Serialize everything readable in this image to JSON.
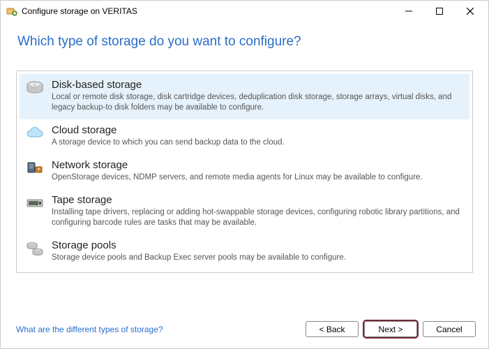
{
  "window": {
    "title": "Configure storage on VERITAS",
    "minimize": "Minimize",
    "maximize": "Maximize",
    "close": "Close"
  },
  "heading": "Which type of storage do you want to configure?",
  "options": [
    {
      "title": "Disk-based storage",
      "desc": "Local or remote disk storage, disk cartridge devices, deduplication disk storage, storage arrays, virtual disks, and legacy backup-to disk folders may be available to configure.",
      "selected": true,
      "icon": "disk-icon"
    },
    {
      "title": "Cloud storage",
      "desc": "A storage device to which you can send backup data to the cloud.",
      "selected": false,
      "icon": "cloud-icon"
    },
    {
      "title": "Network storage",
      "desc": "OpenStorage devices, NDMP servers, and remote media agents for Linux may be available to configure.",
      "selected": false,
      "icon": "network-icon"
    },
    {
      "title": "Tape storage",
      "desc": "Installing tape drivers, replacing or adding hot-swappable storage devices, configuring robotic library partitions, and configuring barcode rules are tasks that may be available.",
      "selected": false,
      "icon": "tape-icon"
    },
    {
      "title": "Storage pools",
      "desc": "Storage device pools and Backup Exec server pools may be available to configure.",
      "selected": false,
      "icon": "pools-icon"
    }
  ],
  "help_link": "What are the different types of storage?",
  "buttons": {
    "back": "< Back",
    "next": "Next >",
    "cancel": "Cancel"
  }
}
